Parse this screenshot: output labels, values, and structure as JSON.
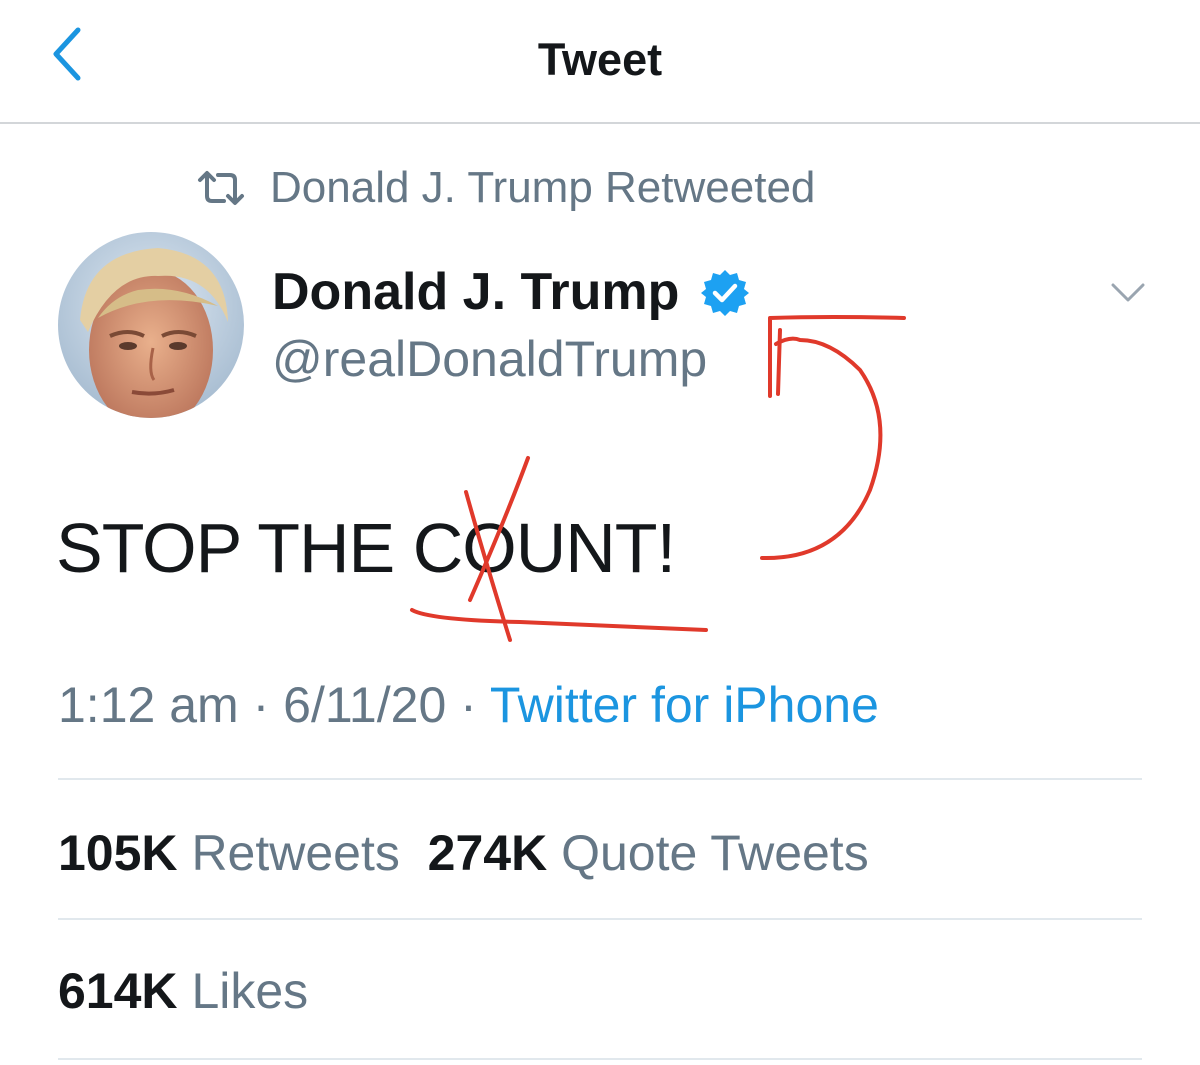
{
  "header": {
    "title": "Tweet",
    "back_icon": "chevron-left-icon"
  },
  "retweet_context": {
    "label": "Donald J. Trump Retweeted",
    "icon": "retweet-icon"
  },
  "author": {
    "display_name": "Donald J. Trump",
    "handle": "@realDonaldTrump",
    "verified": true
  },
  "tweet": {
    "text_part1": "STOP THE C",
    "text_part2": "O",
    "text_part3": "UNT!",
    "time": "1:12 am",
    "separator": "·",
    "date": "6/11/20",
    "source": "Twitter for iPhone"
  },
  "stats": {
    "retweets_count": "105K",
    "retweets_label": "Retweets",
    "quotes_count": "274K",
    "quotes_label": "Quote Tweets",
    "likes_count": "614K",
    "likes_label": "Likes"
  },
  "colors": {
    "accent": "#1b95e0",
    "verified": "#1da1f2",
    "secondary_text": "#657786",
    "annotation_red": "#e0392b"
  }
}
